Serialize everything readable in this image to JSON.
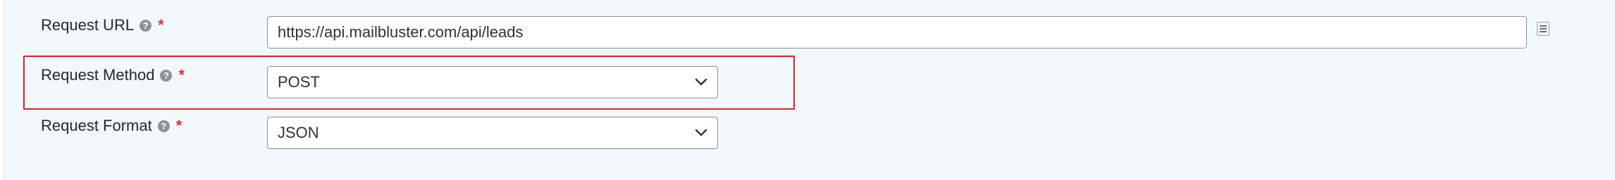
{
  "form": {
    "request_url": {
      "label": "Request URL",
      "help_icon": "question-circle-icon",
      "required_marker": "*",
      "value": "https://api.mailbluster.com/api/leads",
      "merge_tag_icon": "merge-tags-icon"
    },
    "request_method": {
      "label": "Request Method",
      "help_icon": "question-circle-icon",
      "required_marker": "*",
      "selected": "POST",
      "dropdown_icon": "chevron-down-icon"
    },
    "request_format": {
      "label": "Request Format",
      "help_icon": "question-circle-icon",
      "required_marker": "*",
      "selected": "JSON",
      "dropdown_icon": "chevron-down-icon"
    }
  },
  "colors": {
    "panel_background": "#f3f8fc",
    "required": "#d63638",
    "highlight_border": "#d9232f"
  }
}
